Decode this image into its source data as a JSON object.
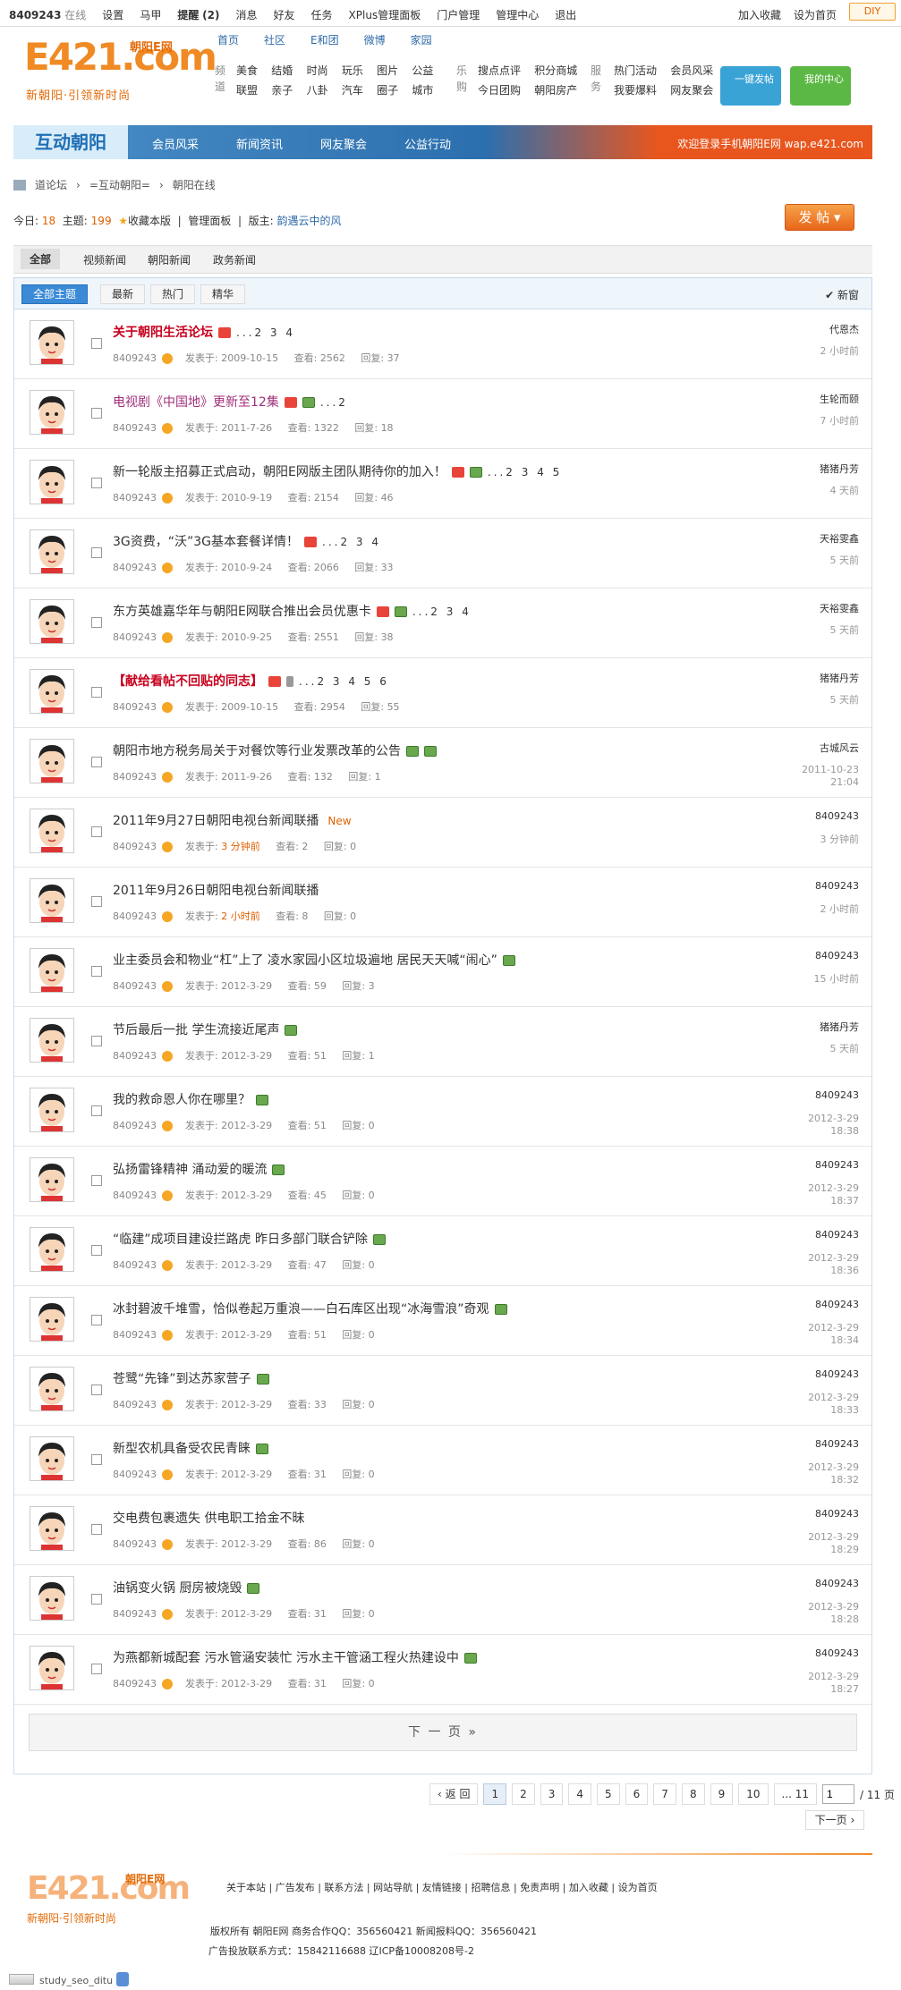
{
  "topbar": {
    "user": "8409243",
    "status": "在线",
    "links": [
      "设置",
      "马甲",
      "提醒",
      "(2)",
      "消息",
      "好友",
      "任务",
      "XPlus管理面板",
      "门户管理",
      "管理中心",
      "退出"
    ],
    "right": [
      "加入收藏",
      "设为首页"
    ],
    "diy": "DIY"
  },
  "header": {
    "logo": "E421.com",
    "logo_cn": "朝阳E网",
    "slogan": "新朝阳·引领新时尚",
    "nav_top": [
      "首页",
      "社区",
      "E和团",
      "微博",
      "家园"
    ],
    "v1": "频道",
    "v2": "乐购",
    "v3": "服务",
    "grid": [
      [
        "美食",
        "结婚",
        "时尚",
        "玩乐",
        "图片",
        "公益"
      ],
      [
        "联盟",
        "亲子",
        "八卦",
        "汽车",
        "圈子",
        "城市"
      ]
    ],
    "grid2": [
      [
        "搜点点评",
        "积分商城"
      ],
      [
        "今日团购",
        "朝阳房产"
      ]
    ],
    "grid3": [
      [
        "热门活动",
        "会员风采"
      ],
      [
        "我要爆料",
        "网友聚会"
      ]
    ],
    "btn1": "一键发帖",
    "btn2": "我的中心"
  },
  "banner": {
    "title": "互动朝阳",
    "tabs": [
      "会员风采",
      "新闻资讯",
      "网友聚会",
      "公益行动"
    ],
    "right": "欢迎登录手机朝阳E网  wap.e421.com"
  },
  "breadcrumb": [
    "道论坛",
    "›",
    "=互动朝阳=",
    "›",
    "朝阳在线"
  ],
  "stats": {
    "today_label": "今日:",
    "today": "18",
    "topic_label": "主题:",
    "topic": "199",
    "fav": "收藏本版",
    "panel": "管理面板",
    "mod_label": "版主:",
    "mod": "韵遇云中的风",
    "post": "发 帖"
  },
  "cats": [
    "全部",
    "视频新闻",
    "朝阳新闻",
    "政务新闻"
  ],
  "filters": [
    "全部主题",
    "最新",
    "热门",
    "精华"
  ],
  "new_window": "新窗",
  "threads": [
    {
      "title": "关于朝阳生活论坛",
      "color": "#c8001e",
      "bold": true,
      "icons": [
        "hot"
      ],
      "pages": "...2 3 4",
      "author": "8409243",
      "date": "2009-10-15",
      "views": "2562",
      "replies": "37",
      "last": "代恩杰",
      "time": "2 小时前"
    },
    {
      "title": "电视剧《中国地》更新至12集",
      "color": "#a0307a",
      "bold": false,
      "icons": [
        "hot",
        "img"
      ],
      "pages": "...2",
      "author": "8409243",
      "date": "2011-7-26",
      "views": "1322",
      "replies": "18",
      "last": "生轮而颐",
      "time": "7 小时前"
    },
    {
      "title": "新一轮版主招募正式启动，朝阳E网版主团队期待你的加入！",
      "color": "#333",
      "bold": false,
      "icons": [
        "hot",
        "img"
      ],
      "pages": "...2 3 4 5",
      "author": "8409243",
      "date": "2010-9-19",
      "views": "2154",
      "replies": "46",
      "last": "猪猪丹芳",
      "time": "4 天前"
    },
    {
      "title": "3G资费，“沃”3G基本套餐详情！",
      "color": "#333",
      "bold": false,
      "icons": [
        "hot"
      ],
      "pages": "...2 3 4",
      "author": "8409243",
      "date": "2010-9-24",
      "views": "2066",
      "replies": "33",
      "last": "天裕雯鑫",
      "time": "5 天前"
    },
    {
      "title": "东方英雄嘉华年与朝阳E网联合推出会员优惠卡",
      "color": "#333",
      "bold": false,
      "icons": [
        "hot",
        "img"
      ],
      "pages": "...2 3 4",
      "author": "8409243",
      "date": "2010-9-25",
      "views": "2551",
      "replies": "38",
      "last": "天裕雯鑫",
      "time": "5 天前"
    },
    {
      "title": "【献给看帖不回贴的同志】",
      "color": "#c8001e",
      "bold": true,
      "icons": [
        "hot",
        "att"
      ],
      "pages": "...2 3 4 5 6",
      "author": "8409243",
      "date": "2009-10-15",
      "views": "2954",
      "replies": "55",
      "last": "猪猪丹芳",
      "time": "5 天前"
    },
    {
      "title": "朝阳市地方税务局关于对餐饮等行业发票改革的公告",
      "color": "#333",
      "bold": false,
      "icons": [
        "img",
        "img"
      ],
      "pages": "",
      "author": "8409243",
      "date": "2011-9-26",
      "views": "132",
      "replies": "1",
      "last": "古城风云",
      "time": "2011-10-23 21:04"
    },
    {
      "title": "2011年9月27日朝阳电视台新闻联播",
      "color": "#333",
      "bold": false,
      "icons": [],
      "pages": "",
      "new": "New",
      "author": "8409243",
      "date": "3 分钟前",
      "dred": true,
      "views": "2",
      "replies": "0",
      "last": "8409243",
      "time": "3 分钟前"
    },
    {
      "title": "2011年9月26日朝阳电视台新闻联播",
      "color": "#333",
      "bold": false,
      "icons": [],
      "pages": "",
      "author": "8409243",
      "date": "2 小时前",
      "dred": true,
      "views": "8",
      "replies": "0",
      "last": "8409243",
      "time": "2 小时前"
    },
    {
      "title": "业主委员会和物业“杠”上了  凌水家园小区垃圾遍地  居民天天喊“闹心”",
      "color": "#333",
      "bold": false,
      "icons": [
        "img"
      ],
      "pages": "",
      "author": "8409243",
      "date": "2012-3-29",
      "views": "59",
      "replies": "3",
      "last": "8409243",
      "time": "15 小时前"
    },
    {
      "title": "节后最后一批  学生流接近尾声",
      "color": "#333",
      "bold": false,
      "icons": [
        "img"
      ],
      "pages": "",
      "author": "8409243",
      "date": "2012-3-29",
      "views": "51",
      "replies": "1",
      "last": "猪猪丹芳",
      "time": "5 天前"
    },
    {
      "title": "我的救命恩人你在哪里？",
      "color": "#333",
      "bold": false,
      "icons": [
        "img"
      ],
      "pages": "",
      "author": "8409243",
      "date": "2012-3-29",
      "views": "51",
      "replies": "0",
      "last": "8409243",
      "time": "2012-3-29 18:38"
    },
    {
      "title": "弘扬雷锋精神  涌动爱的暖流",
      "color": "#333",
      "bold": false,
      "icons": [
        "img"
      ],
      "pages": "",
      "author": "8409243",
      "date": "2012-3-29",
      "views": "45",
      "replies": "0",
      "last": "8409243",
      "time": "2012-3-29 18:37"
    },
    {
      "title": "“临建”成项目建设拦路虎  昨日多部门联合铲除",
      "color": "#333",
      "bold": false,
      "icons": [
        "img"
      ],
      "pages": "",
      "author": "8409243",
      "date": "2012-3-29",
      "views": "47",
      "replies": "0",
      "last": "8409243",
      "time": "2012-3-29 18:36"
    },
    {
      "title": "冰封碧波千堆雪，恰似卷起万重浪——白石库区出现“冰海雪浪”奇观",
      "color": "#333",
      "bold": false,
      "icons": [
        "img"
      ],
      "pages": "",
      "author": "8409243",
      "date": "2012-3-29",
      "views": "51",
      "replies": "0",
      "last": "8409243",
      "time": "2012-3-29 18:34"
    },
    {
      "title": "苍鹭“先锋”到达苏家营子",
      "color": "#333",
      "bold": false,
      "icons": [
        "img"
      ],
      "pages": "",
      "author": "8409243",
      "date": "2012-3-29",
      "views": "33",
      "replies": "0",
      "last": "8409243",
      "time": "2012-3-29 18:33"
    },
    {
      "title": "新型农机具备受农民青睐",
      "color": "#333",
      "bold": false,
      "icons": [
        "img"
      ],
      "pages": "",
      "author": "8409243",
      "date": "2012-3-29",
      "views": "31",
      "replies": "0",
      "last": "8409243",
      "time": "2012-3-29 18:32"
    },
    {
      "title": "交电费包裹遗失  供电职工拾金不昧",
      "color": "#333",
      "bold": false,
      "icons": [],
      "pages": "",
      "author": "8409243",
      "date": "2012-3-29",
      "views": "86",
      "replies": "0",
      "last": "8409243",
      "time": "2012-3-29 18:29"
    },
    {
      "title": "油锅变火锅  厨房被烧毁",
      "color": "#333",
      "bold": false,
      "icons": [
        "img"
      ],
      "pages": "",
      "author": "8409243",
      "date": "2012-3-29",
      "views": "31",
      "replies": "0",
      "last": "8409243",
      "time": "2012-3-29 18:28"
    },
    {
      "title": "为燕都新城配套  污水管涵安装忙  污水主干管涵工程火热建设中",
      "color": "#333",
      "bold": false,
      "icons": [
        "img"
      ],
      "pages": "",
      "author": "8409243",
      "date": "2012-3-29",
      "views": "31",
      "replies": "0",
      "last": "8409243",
      "time": "2012-3-29 18:27"
    }
  ],
  "labels": {
    "posted": "发表于:",
    "views": "查看:",
    "replies": "回复:"
  },
  "next_page": "下 一 页   »",
  "pager": {
    "back": "返 回",
    "pages": [
      "1",
      "2",
      "3",
      "4",
      "5",
      "6",
      "7",
      "8",
      "9",
      "10",
      "... 11"
    ],
    "input": "1",
    "total": "/ 11 页",
    "next": "下一页"
  },
  "footer": {
    "logo": "E421.com",
    "logo_cn": "朝阳E网",
    "slogan": "新朝阳·引领新时尚",
    "links": "关于本站 | 广告发布 | 联系方法 | 网站导航 | 友情链接 | 招聘信息 | 免责声明 | 加入收藏 | 设为首页",
    "line2": "版权所有  朝阳E网  商务合作QQ：356560421     新闻报料QQ：356560421",
    "line3": "广告投放联系方式：15842116688  辽ICP备10008208号-2"
  },
  "statusbar": "study_seo_ditu"
}
